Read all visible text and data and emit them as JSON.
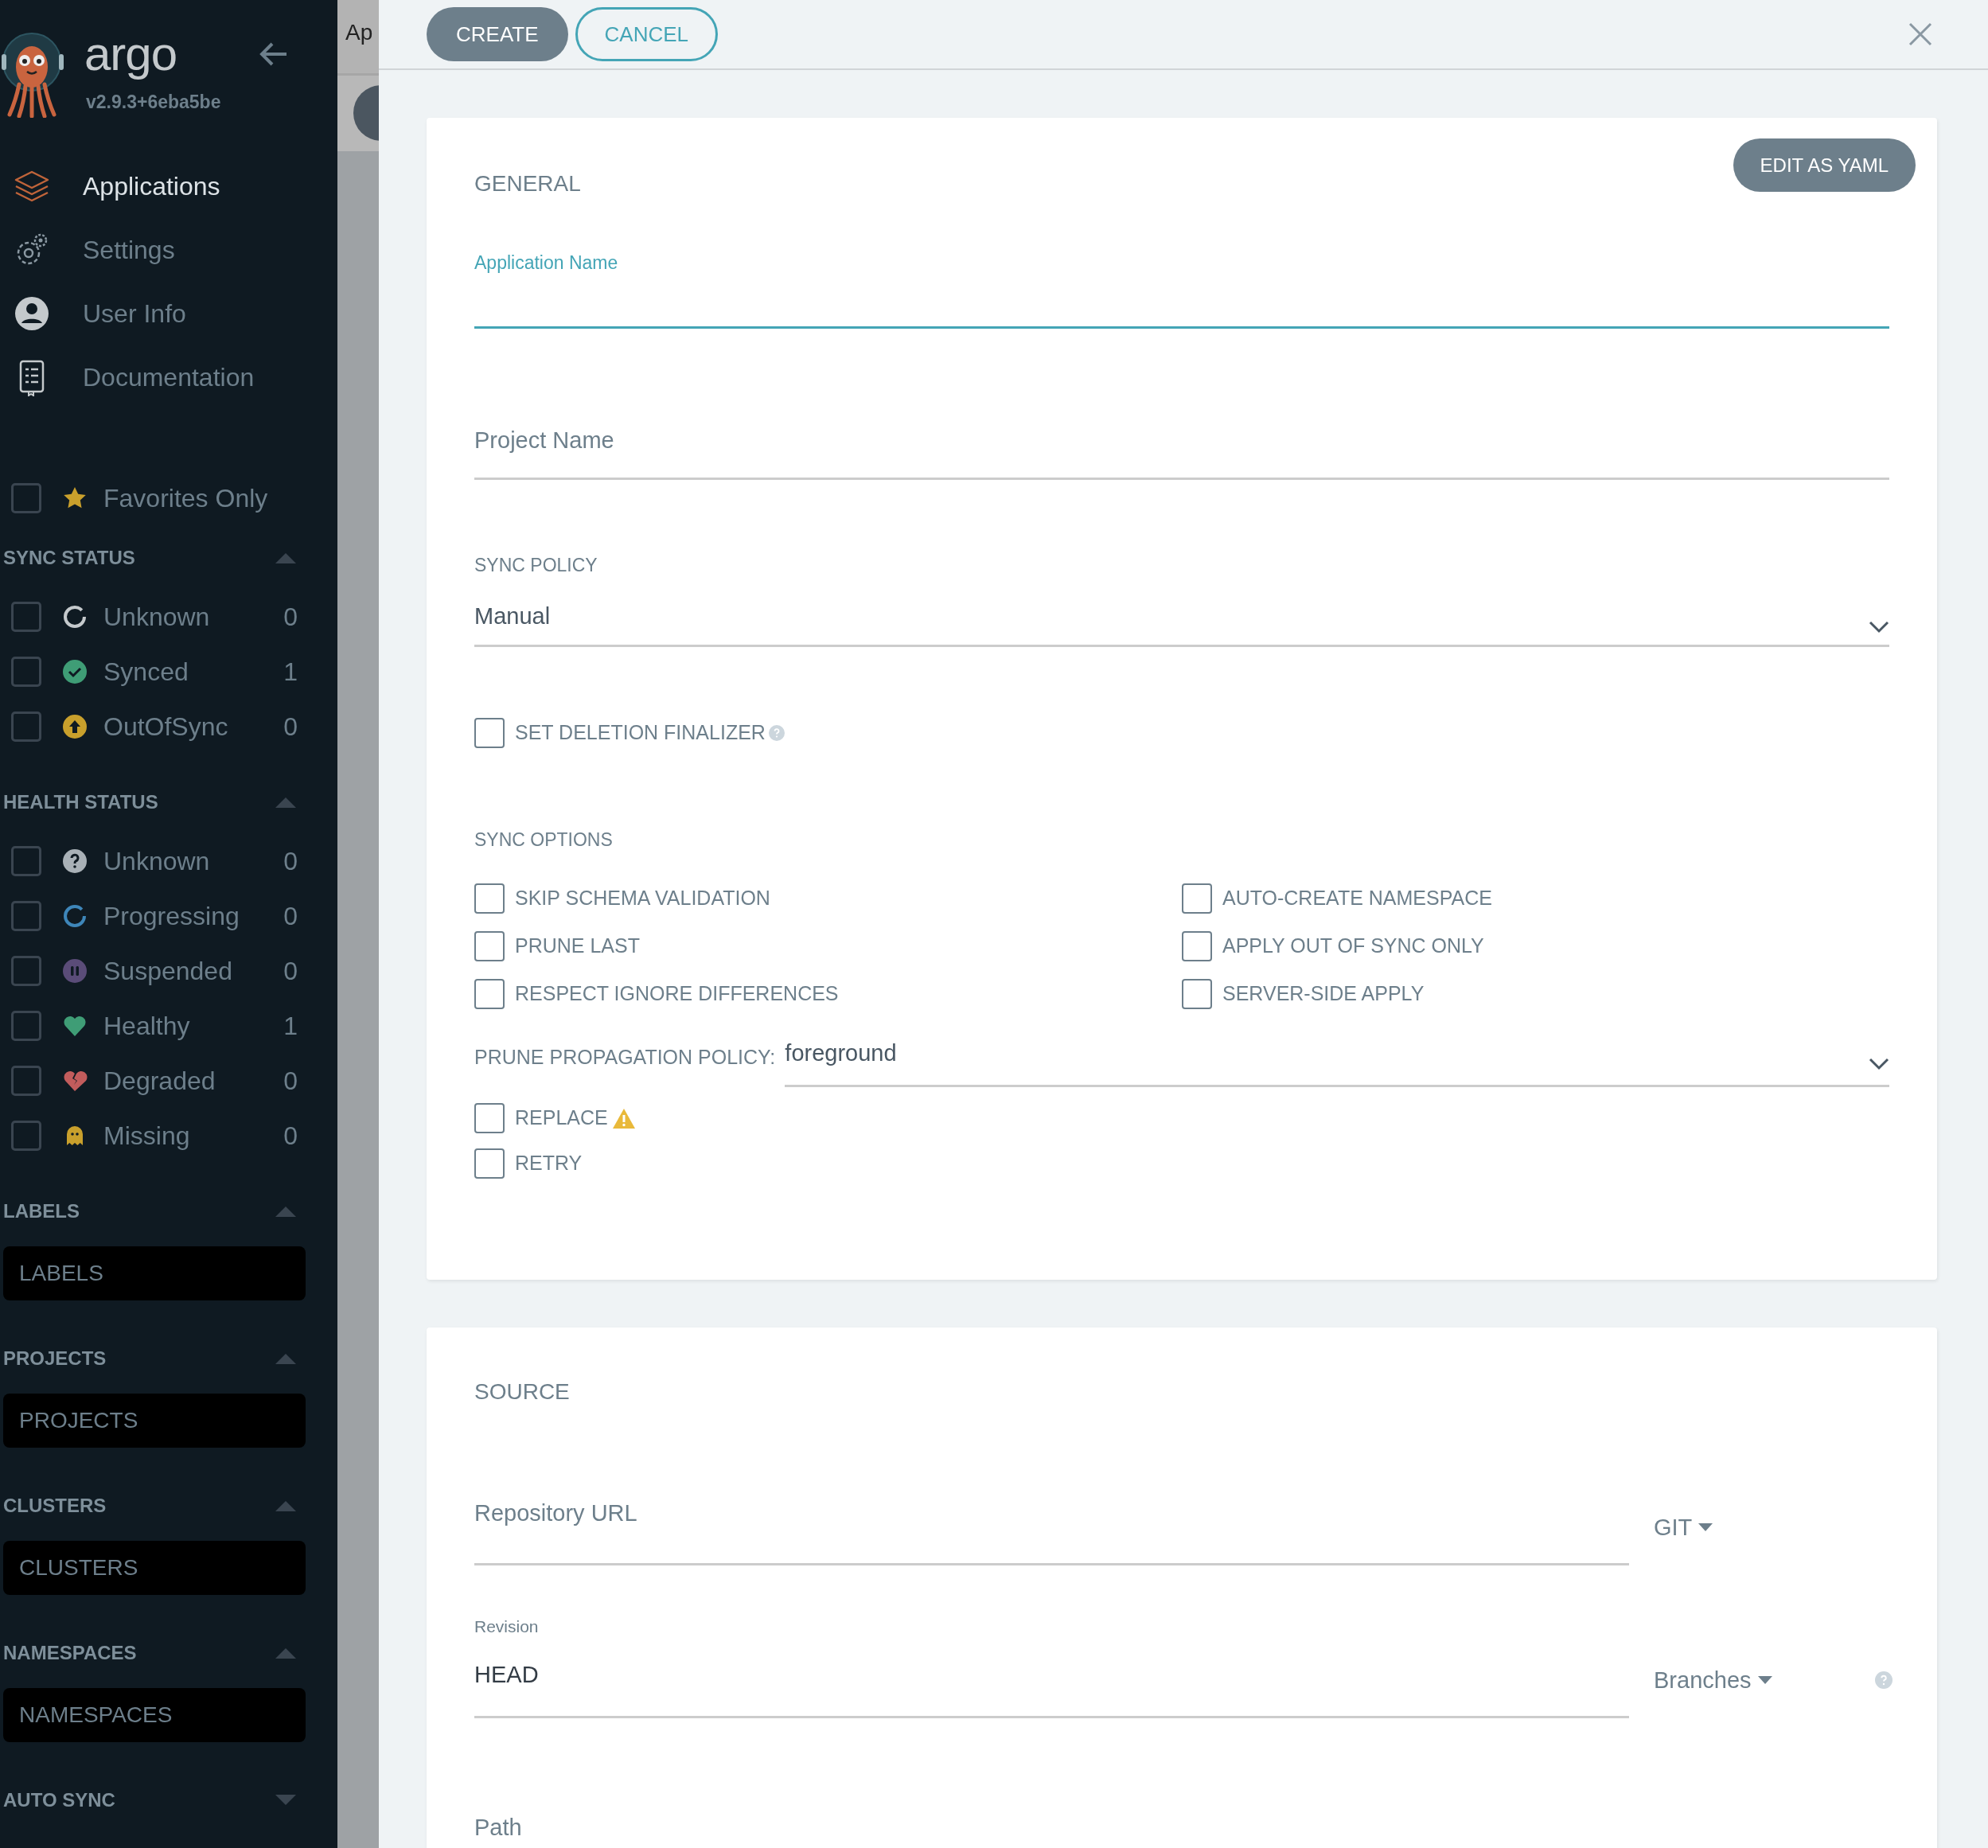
{
  "background_page": {
    "title_fragment": "Ap"
  },
  "sidebar": {
    "brand": "argo",
    "version": "v2.9.3+6eba5be",
    "nav": [
      {
        "label": "Applications",
        "kind": "applications",
        "selected": true
      },
      {
        "label": "Settings",
        "kind": "settings",
        "selected": false
      },
      {
        "label": "User Info",
        "kind": "user",
        "selected": false
      },
      {
        "label": "Documentation",
        "kind": "docs",
        "selected": false
      }
    ],
    "favorites": {
      "label": "Favorites Only",
      "checked": false
    },
    "filter_groups": [
      {
        "title": "SYNC STATUS",
        "kind": "checklist",
        "expanded": true,
        "items": [
          {
            "label": "Unknown",
            "kind": "sync-unknown",
            "count": "0",
            "checked": false
          },
          {
            "label": "Synced",
            "kind": "synced",
            "count": "1",
            "checked": false
          },
          {
            "label": "OutOfSync",
            "kind": "out-of-sync",
            "count": "0",
            "checked": false
          }
        ]
      },
      {
        "title": "HEALTH STATUS",
        "kind": "checklist",
        "expanded": true,
        "items": [
          {
            "label": "Unknown",
            "kind": "health-unknown",
            "count": "0",
            "checked": false
          },
          {
            "label": "Progressing",
            "kind": "progressing",
            "count": "0",
            "checked": false
          },
          {
            "label": "Suspended",
            "kind": "suspended",
            "count": "0",
            "checked": false
          },
          {
            "label": "Healthy",
            "kind": "healthy",
            "count": "1",
            "checked": false
          },
          {
            "label": "Degraded",
            "kind": "degraded",
            "count": "0",
            "checked": false
          },
          {
            "label": "Missing",
            "kind": "missing",
            "count": "0",
            "checked": false
          }
        ]
      },
      {
        "title": "LABELS",
        "kind": "input",
        "expanded": true,
        "placeholder": "LABELS"
      },
      {
        "title": "PROJECTS",
        "kind": "input",
        "expanded": true,
        "placeholder": "PROJECTS"
      },
      {
        "title": "CLUSTERS",
        "kind": "input",
        "expanded": true,
        "placeholder": "CLUSTERS"
      },
      {
        "title": "NAMESPACES",
        "kind": "input",
        "expanded": true,
        "placeholder": "NAMESPACES"
      },
      {
        "title": "AUTO SYNC",
        "kind": "checklist",
        "expanded": false
      }
    ]
  },
  "panel": {
    "buttons": [
      {
        "label": "CREATE",
        "kind": "primary"
      },
      {
        "label": "CANCEL",
        "kind": "outline"
      }
    ],
    "general": {
      "title": "GENERAL",
      "edit_button": "EDIT AS YAML",
      "application_name": {
        "label": "Application Name",
        "focused": true
      },
      "project_name": {
        "placeholder": "Project Name"
      },
      "sync_policy": {
        "label": "SYNC POLICY",
        "value": "Manual"
      },
      "set_deletion_finalizer": {
        "label": "SET DELETION FINALIZER",
        "checked": false
      },
      "sync_options": {
        "title": "SYNC OPTIONS",
        "options": [
          {
            "label": "SKIP SCHEMA VALIDATION",
            "checked": false
          },
          {
            "label": "AUTO-CREATE NAMESPACE",
            "checked": false
          },
          {
            "label": "PRUNE LAST",
            "checked": false
          },
          {
            "label": "APPLY OUT OF SYNC ONLY",
            "checked": false
          },
          {
            "label": "RESPECT IGNORE DIFFERENCES",
            "checked": false
          },
          {
            "label": "SERVER-SIDE APPLY",
            "checked": false
          }
        ]
      },
      "prune_propagation_policy": {
        "label": "PRUNE PROPAGATION POLICY:",
        "value": "foreground"
      },
      "extra_options": [
        {
          "label": "REPLACE",
          "checked": false,
          "warning": true
        },
        {
          "label": "RETRY",
          "checked": false,
          "warning": false
        }
      ]
    },
    "source": {
      "title": "SOURCE",
      "repository_url": {
        "placeholder": "Repository URL"
      },
      "repo_type": "GIT",
      "revision": {
        "label": "Revision",
        "value": "HEAD"
      },
      "revision_type": "Branches",
      "path": {
        "placeholder": "Path"
      }
    }
  }
}
